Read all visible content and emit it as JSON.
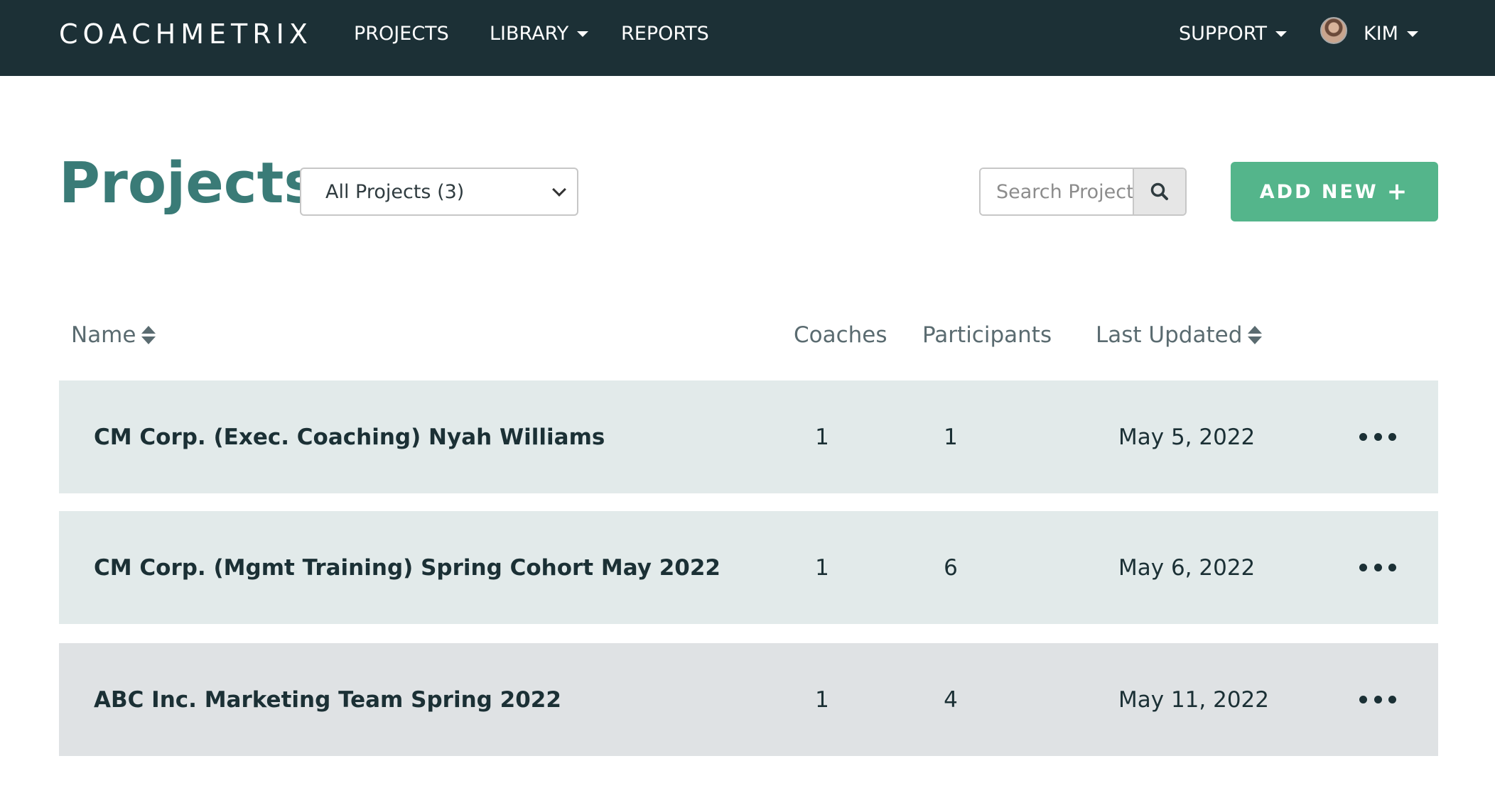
{
  "nav": {
    "brand": "COACHMETRIX",
    "projects": "PROJECTS",
    "library": "LIBRARY",
    "reports": "REPORTS",
    "support": "SUPPORT",
    "user": "KIM"
  },
  "header": {
    "title": "Projects",
    "filter_selected": "All Projects (3)",
    "search_placeholder": "Search Projects",
    "add_new_label": "ADD NEW"
  },
  "table": {
    "columns": {
      "name": "Name",
      "coaches": "Coaches",
      "participants": "Participants",
      "last_updated": "Last Updated"
    },
    "rows": [
      {
        "name": "CM Corp. (Exec. Coaching) Nyah Williams",
        "coaches": "1",
        "participants": "1",
        "last_updated": "May 5, 2022"
      },
      {
        "name": "CM Corp. (Mgmt Training) Spring Cohort May 2022",
        "coaches": "1",
        "participants": "6",
        "last_updated": "May 6, 2022"
      },
      {
        "name": "ABC Inc. Marketing Team Spring 2022",
        "coaches": "1",
        "participants": "4",
        "last_updated": "May 11, 2022"
      }
    ]
  },
  "colors": {
    "navbar": "#1c3036",
    "title": "#3a7b77",
    "add_button": "#54b58b",
    "row_teal": "#e2eaea",
    "row_gray": "#dfe2e4"
  },
  "icons": {
    "search": "search-icon",
    "more": "more-options-icon",
    "sort": "sort-icon"
  }
}
